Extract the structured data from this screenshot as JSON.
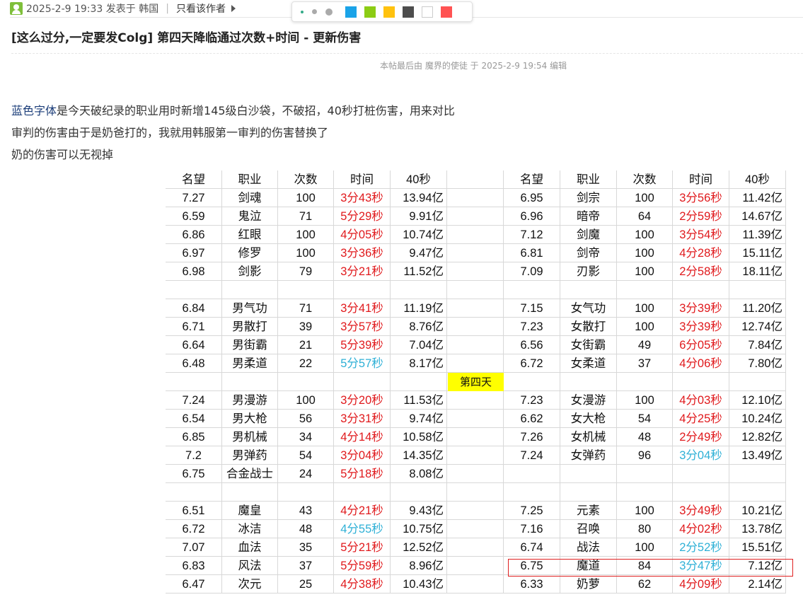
{
  "topbar": {
    "post_meta": "2025-2-9 19:33 发表于 韩国",
    "separator": "|",
    "only_author": "只看该作者"
  },
  "palette": {
    "swatches": [
      "#1aa3e8",
      "#8ccc14",
      "#ffc20e",
      "#4d4d4d",
      "#ffffff",
      "#ff5252"
    ]
  },
  "post": {
    "title": "[这么过分,一定要发Colg] 第四天降临通过次数+时间 - 更新伤害",
    "edit_note": "本帖最后由 魔界的使徒 于 2025-2-9 19:54 编辑",
    "line1_highlight": "蓝色字体",
    "line1_rest": "是今天破纪录的职业用时新增145级白沙袋，不破招，40秒打桩伤害，用来对比",
    "line2": "审判的伤害由于是奶爸打的，我就用韩服第一审判的伤害替换了",
    "line3": "奶的伤害可以无视掉"
  },
  "table": {
    "headers": [
      "名望",
      "职业",
      "次数",
      "时间",
      "40秒"
    ],
    "day_label": "第四天",
    "colors": {
      "red": "#e0191c",
      "blue": "#2eb0d6",
      "highlight_box": "#e02020",
      "day_badge": "#ffff00"
    },
    "left": [
      [
        "7.27",
        "剑魂",
        "100",
        "3分43秒",
        "13.94亿",
        "r"
      ],
      [
        "6.59",
        "鬼泣",
        "71",
        "5分29秒",
        "9.91亿",
        "r"
      ],
      [
        "6.86",
        "红眼",
        "100",
        "4分05秒",
        "10.74亿",
        "r"
      ],
      [
        "6.97",
        "修罗",
        "100",
        "3分36秒",
        "9.47亿",
        "r"
      ],
      [
        "6.98",
        "剑影",
        "79",
        "3分21秒",
        "11.52亿",
        "r"
      ],
      null,
      [
        "6.84",
        "男气功",
        "71",
        "3分41秒",
        "11.19亿",
        "r"
      ],
      [
        "6.71",
        "男散打",
        "39",
        "3分57秒",
        "8.76亿",
        "r"
      ],
      [
        "6.64",
        "男街霸",
        "21",
        "5分39秒",
        "7.04亿",
        "r"
      ],
      [
        "6.48",
        "男柔道",
        "22",
        "5分57秒",
        "8.17亿",
        "b"
      ],
      null,
      [
        "7.24",
        "男漫游",
        "100",
        "3分20秒",
        "11.53亿",
        "r"
      ],
      [
        "6.54",
        "男大枪",
        "56",
        "3分31秒",
        "9.74亿",
        "r"
      ],
      [
        "6.85",
        "男机械",
        "34",
        "4分14秒",
        "10.58亿",
        "r"
      ],
      [
        "7.2",
        "男弹药",
        "54",
        "3分04秒",
        "14.35亿",
        "r"
      ],
      [
        "6.75",
        "合金战士",
        "24",
        "5分18秒",
        "8.08亿",
        "r"
      ],
      null,
      [
        "6.51",
        "魔皇",
        "43",
        "4分21秒",
        "9.43亿",
        "r"
      ],
      [
        "6.72",
        "冰洁",
        "48",
        "4分55秒",
        "10.75亿",
        "b"
      ],
      [
        "7.07",
        "血法",
        "35",
        "5分21秒",
        "12.52亿",
        "r"
      ],
      [
        "6.83",
        "风法",
        "37",
        "5分59秒",
        "8.96亿",
        "r"
      ],
      [
        "6.47",
        "次元",
        "25",
        "4分38秒",
        "10.43亿",
        "r"
      ]
    ],
    "right": [
      [
        "6.95",
        "剑宗",
        "100",
        "3分56秒",
        "11.42亿",
        "r"
      ],
      [
        "6.96",
        "暗帝",
        "64",
        "2分59秒",
        "14.67亿",
        "r"
      ],
      [
        "7.12",
        "剑魔",
        "100",
        "3分54秒",
        "11.39亿",
        "r"
      ],
      [
        "6.81",
        "剑帝",
        "100",
        "4分28秒",
        "15.11亿",
        "r"
      ],
      [
        "7.09",
        "刃影",
        "100",
        "2分58秒",
        "18.11亿",
        "r"
      ],
      null,
      [
        "7.15",
        "女气功",
        "100",
        "3分39秒",
        "11.20亿",
        "r"
      ],
      [
        "7.23",
        "女散打",
        "100",
        "3分39秒",
        "12.74亿",
        "r"
      ],
      [
        "6.56",
        "女街霸",
        "49",
        "6分05秒",
        "7.84亿",
        "r"
      ],
      [
        "6.72",
        "女柔道",
        "37",
        "4分06秒",
        "7.80亿",
        "r"
      ],
      null,
      [
        "7.23",
        "女漫游",
        "100",
        "4分03秒",
        "12.10亿",
        "r"
      ],
      [
        "6.62",
        "女大枪",
        "54",
        "4分25秒",
        "10.24亿",
        "r"
      ],
      [
        "7.26",
        "女机械",
        "48",
        "2分49秒",
        "12.82亿",
        "r"
      ],
      [
        "7.24",
        "女弹药",
        "96",
        "3分04秒",
        "13.49亿",
        "b"
      ],
      null,
      null,
      [
        "7.25",
        "元素",
        "100",
        "3分49秒",
        "10.21亿",
        "r"
      ],
      [
        "7.16",
        "召唤",
        "80",
        "4分02秒",
        "13.78亿",
        "r"
      ],
      [
        "6.74",
        "战法",
        "100",
        "2分52秒",
        "15.51亿",
        "b"
      ],
      [
        "6.75",
        "魔道",
        "84",
        "3分47秒",
        "7.12亿",
        "b"
      ],
      [
        "6.33",
        "奶萝",
        "62",
        "4分09秒",
        "2.14亿",
        "r"
      ]
    ]
  }
}
